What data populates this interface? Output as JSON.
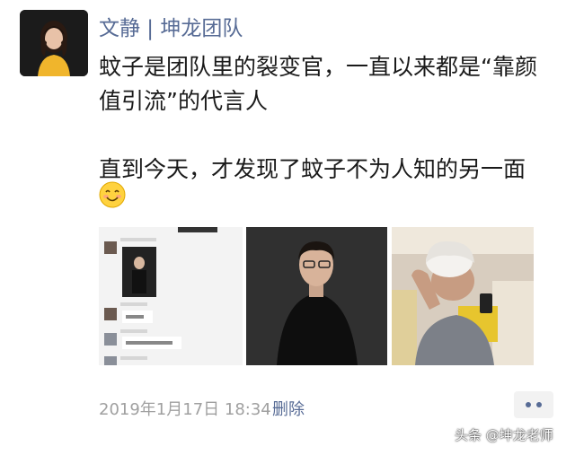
{
  "post": {
    "author": "文静 | 坤龙团队",
    "lines": [
      "蚊子是团队里的裂变官，一直以来都是“靠颜值引流”的代言人",
      "直到今天，才发现了蚊子不为人知的另一面"
    ],
    "emoji_icon": "smiling-face-emoji",
    "photos": [
      {
        "icon": "chat-screenshot-photo"
      },
      {
        "icon": "portrait-man-photo"
      },
      {
        "icon": "man-in-wig-photo"
      }
    ],
    "timestamp": "2019年1月17日 18:34",
    "delete_label": "删除",
    "more_icon": "more-dots-icon"
  },
  "watermark": "头条 @坤龙老师",
  "colors": {
    "link": "#576b95",
    "text": "#1a1a1a",
    "meta": "#a0a0a0"
  }
}
